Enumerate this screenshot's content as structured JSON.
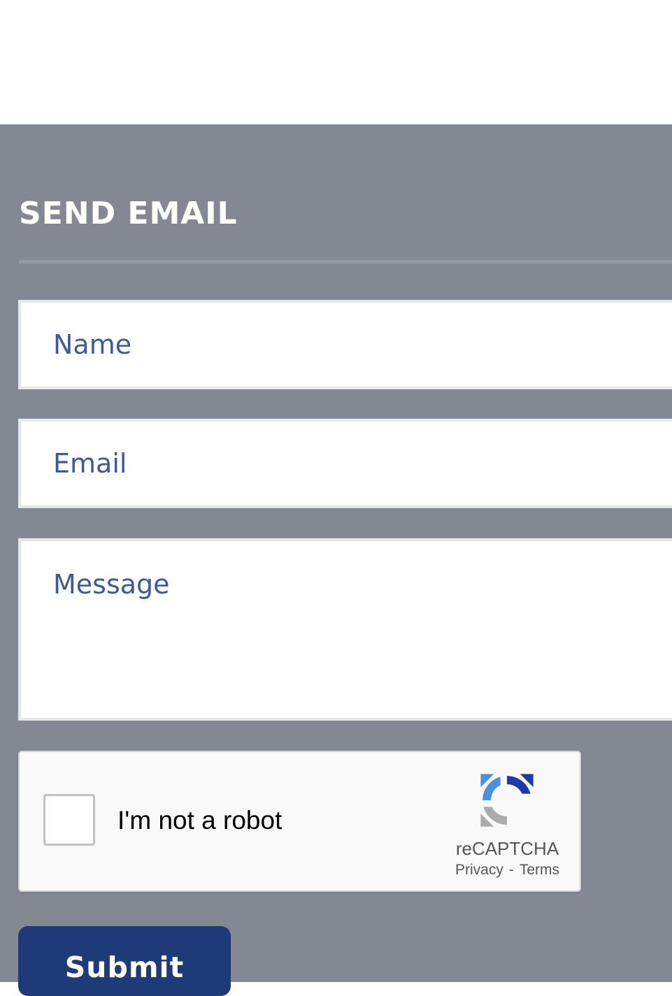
{
  "form": {
    "title": "SEND EMAIL",
    "name_placeholder": "Name",
    "email_placeholder": "Email",
    "message_placeholder": "Message",
    "submit_label": "Submit"
  },
  "recaptcha": {
    "checkbox_label": "I'm not a robot",
    "brand": "reCAPTCHA",
    "privacy_link": "Privacy",
    "separator": "-",
    "terms_link": "Terms",
    "logo_icon": "recaptcha-logo-icon"
  },
  "colors": {
    "panel_background": "#838892",
    "placeholder_text": "#3d5a98",
    "submit_button": "#1e3a78"
  }
}
